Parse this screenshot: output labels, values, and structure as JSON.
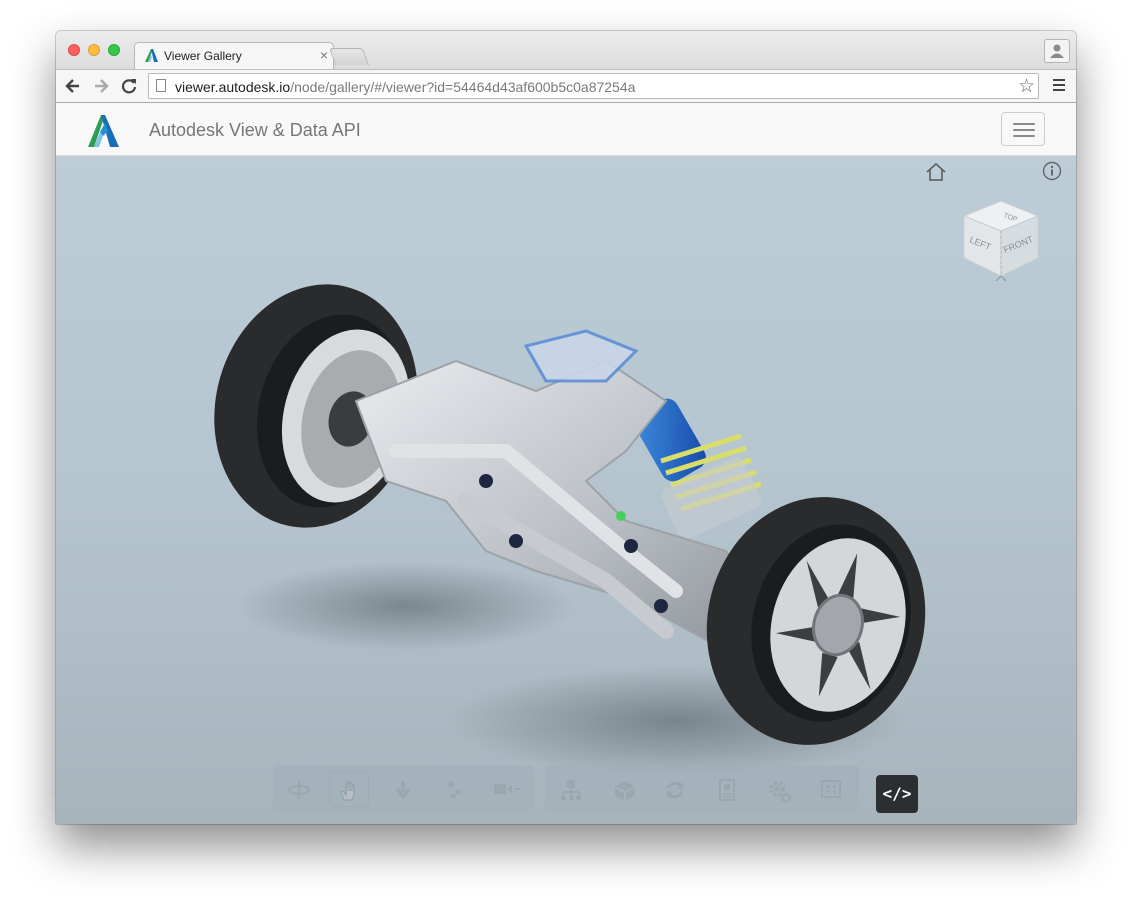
{
  "browser": {
    "tab_title": "Viewer Gallery",
    "tab_close": "×",
    "url_host": "viewer.autodesk.io",
    "url_path": "/node/gallery/#/viewer?id=54464d43af600b5c0a87254a",
    "icons": [
      "back-icon",
      "forward-icon",
      "reload-icon",
      "page-icon",
      "bookmark-star-icon",
      "chrome-menu-icon",
      "profile-icon"
    ]
  },
  "app": {
    "title": "Autodesk View & Data API",
    "brand_colors": [
      "#1a6eb8",
      "#2f9e55",
      "#7ec5e8"
    ]
  },
  "viewer": {
    "viewcube_faces": {
      "top": "TOP",
      "left": "LEFT",
      "front": "FRONT"
    },
    "toolbar_groups": [
      {
        "tools": [
          "orbit-icon",
          "pan-icon",
          "zoom-icon",
          "walk-icon",
          "camera-icon"
        ],
        "active": "pan-icon"
      },
      {
        "tools": [
          "model-structure-icon",
          "explode-icon",
          "rotate-icon",
          "properties-icon",
          "settings-icon",
          "fullscreen-icon"
        ]
      }
    ],
    "code_button_label": "</>",
    "background_top": "#bdcdd7",
    "background_bottom": "#a7b4bc"
  }
}
